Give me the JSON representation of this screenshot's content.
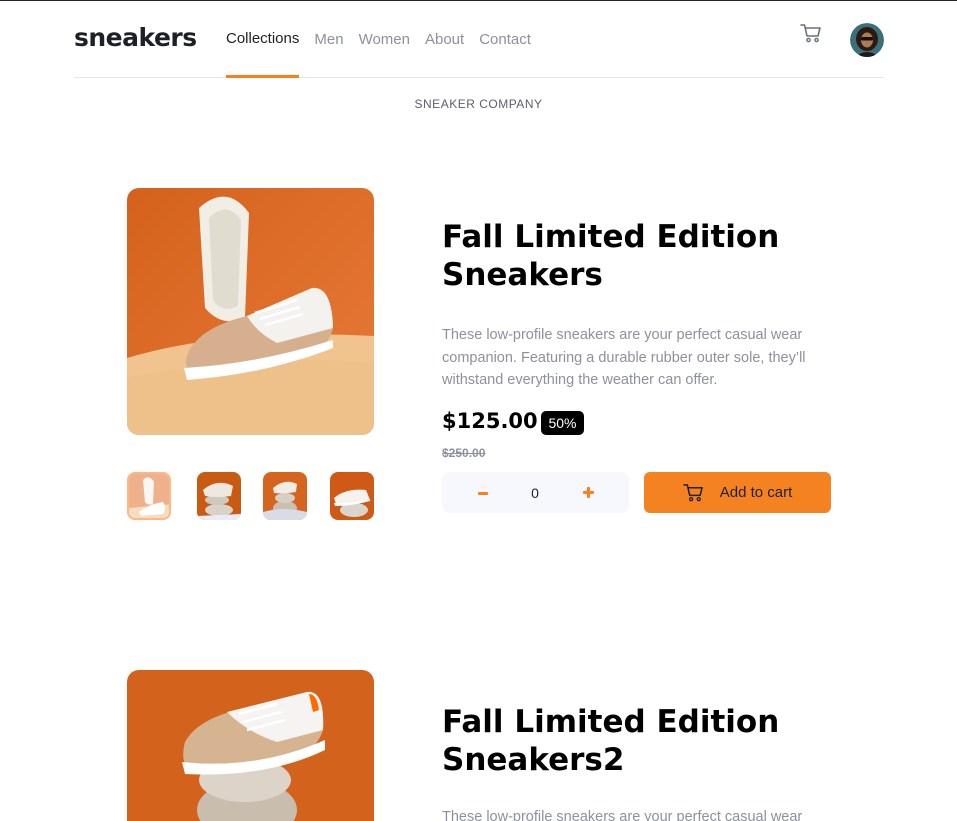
{
  "header": {
    "logo": "sneakers",
    "nav": [
      "Collections",
      "Men",
      "Women",
      "About",
      "Contact"
    ]
  },
  "company": "SNEAKER COMPANY",
  "colors": {
    "accent": "#ff7d1a",
    "button": "#f48221",
    "muted": "#8c919c",
    "qty_bg": "#f6f8fd"
  },
  "icons": {
    "cart": "cart-icon",
    "avatar": "user-avatar",
    "minus": "minus-icon",
    "plus": "plus-icon"
  },
  "products": [
    {
      "title_line1": "Fall Limited Edition",
      "title_line2": "Sneakers",
      "description": "These low-profile sneakers are your perfect casual wear companion. Featuring a durable rubber outer sole, they’ll withstand everything the weather can offer.",
      "price": "$125.00",
      "discount": "50%",
      "old_price": "$250.00",
      "quantity": "0",
      "add_label": "Add to cart"
    },
    {
      "title_line1": "Fall Limited Edition",
      "title_line2": "Sneakers2",
      "description": "These low-profile sneakers are your perfect casual wear"
    }
  ]
}
